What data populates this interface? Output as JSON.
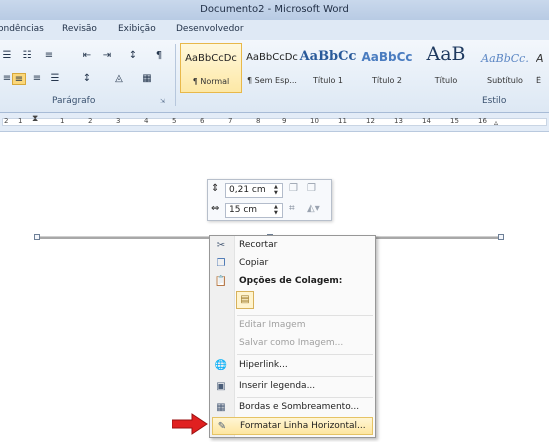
{
  "window": {
    "title": "Documento2 - Microsoft Word"
  },
  "tabs": [
    "ondências",
    "Revisão",
    "Exibição",
    "Desenvolvedor"
  ],
  "ribbon": {
    "paragraph_label": "Parágrafo",
    "styles_label": "Estilo",
    "styles": [
      {
        "preview": "AaBbCcDc",
        "name": "¶ Normal",
        "selected": true
      },
      {
        "preview": "AaBbCcDc",
        "name": "¶ Sem Esp...",
        "selected": false
      },
      {
        "preview": "AaBbCc",
        "name": "Título 1",
        "selected": false
      },
      {
        "preview": "AaBbCc",
        "name": "Título 2",
        "selected": false
      },
      {
        "preview": "AaB",
        "name": "Título",
        "selected": false
      },
      {
        "preview": "AaBbCc.",
        "name": "Subtítulo",
        "selected": false
      },
      {
        "preview": "A",
        "name": "Ê",
        "selected": false
      }
    ],
    "pilcrow": "¶"
  },
  "ruler": {
    "numbers": [
      "2",
      "1",
      "1",
      "2",
      "3",
      "4",
      "5",
      "6",
      "7",
      "8",
      "9",
      "10",
      "11",
      "12",
      "13",
      "14",
      "15",
      "16"
    ]
  },
  "minibar": {
    "height_value": "0,21 cm",
    "width_value": "15 cm"
  },
  "context_menu": {
    "items": [
      {
        "label": "Recortar",
        "icon": "scissors-icon",
        "disabled": false
      },
      {
        "label": "Copiar",
        "icon": "copy-icon",
        "disabled": false
      },
      {
        "label": "Opções de Colagem:",
        "icon": "paste-icon",
        "disabled": false,
        "heading": true
      },
      {
        "label": "Editar Imagem",
        "icon": "",
        "disabled": true
      },
      {
        "label": "Salvar como Imagem...",
        "icon": "",
        "disabled": true
      },
      {
        "label": "Hiperlink...",
        "icon": "hyperlink-icon",
        "disabled": false
      },
      {
        "label": "Inserir legenda...",
        "icon": "caption-icon",
        "disabled": false
      },
      {
        "label": "Bordas e Sombreamento...",
        "icon": "borders-icon",
        "disabled": false
      },
      {
        "label": "Formatar Linha Horizontal...",
        "icon": "format-line-icon",
        "disabled": false,
        "highlighted": true
      }
    ]
  },
  "colors": {
    "arrow": "#e02020",
    "highlight": "#fde6a0"
  }
}
